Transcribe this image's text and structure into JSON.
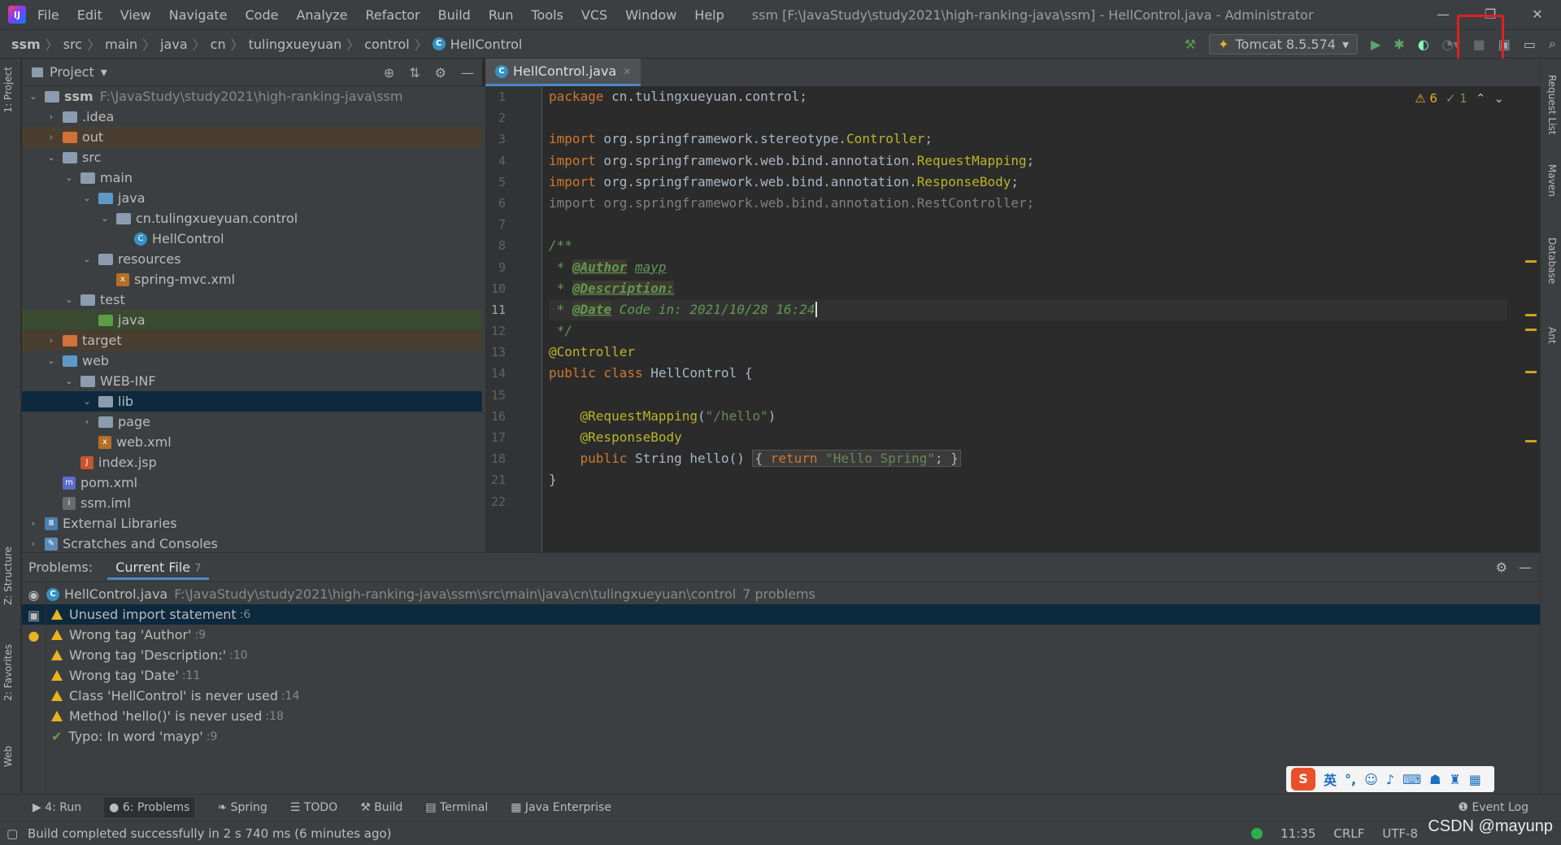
{
  "window": {
    "menu": [
      "File",
      "Edit",
      "View",
      "Navigate",
      "Code",
      "Analyze",
      "Refactor",
      "Build",
      "Run",
      "Tools",
      "VCS",
      "Window",
      "Help"
    ],
    "title": "ssm [F:\\JavaStudy\\study2021\\high-ranking-java\\ssm] - HellControl.java - Administrator"
  },
  "breadcrumb": [
    "ssm",
    "src",
    "main",
    "java",
    "cn",
    "tulingxueyuan",
    "control",
    "HellControl"
  ],
  "run_config": "Tomcat 8.5.574",
  "project": {
    "header": "Project",
    "tree": [
      {
        "label": "ssm",
        "path": "F:\\JavaStudy\\study2021\\high-ranking-java\\ssm",
        "depth": 0,
        "icon": "module",
        "arrow": "open"
      },
      {
        "label": ".idea",
        "depth": 1,
        "icon": "gray",
        "arrow": "closed"
      },
      {
        "label": "out",
        "depth": 1,
        "icon": "orange",
        "arrow": "closed"
      },
      {
        "label": "src",
        "depth": 1,
        "icon": "gray",
        "arrow": "open"
      },
      {
        "label": "main",
        "depth": 2,
        "icon": "gray",
        "arrow": "open"
      },
      {
        "label": "java",
        "depth": 3,
        "icon": "blue",
        "arrow": "open"
      },
      {
        "label": "cn.tulingxueyuan.control",
        "depth": 4,
        "icon": "package",
        "arrow": "open"
      },
      {
        "label": "HellControl",
        "depth": 5,
        "icon": "class",
        "arrow": ""
      },
      {
        "label": "resources",
        "depth": 3,
        "icon": "gray",
        "arrow": "open"
      },
      {
        "label": "spring-mvc.xml",
        "depth": 4,
        "icon": "xml",
        "arrow": ""
      },
      {
        "label": "test",
        "depth": 2,
        "icon": "gray",
        "arrow": "open"
      },
      {
        "label": "java",
        "depth": 3,
        "icon": "green",
        "arrow": ""
      },
      {
        "label": "target",
        "depth": 1,
        "icon": "orange",
        "arrow": "closed"
      },
      {
        "label": "web",
        "depth": 1,
        "icon": "blue",
        "arrow": "open"
      },
      {
        "label": "WEB-INF",
        "depth": 2,
        "icon": "gray",
        "arrow": "open"
      },
      {
        "label": "lib",
        "depth": 3,
        "icon": "gray",
        "arrow": "open"
      },
      {
        "label": "page",
        "depth": 3,
        "icon": "gray",
        "arrow": "closed"
      },
      {
        "label": "web.xml",
        "depth": 3,
        "icon": "xml",
        "arrow": ""
      },
      {
        "label": "index.jsp",
        "depth": 2,
        "icon": "jsp",
        "arrow": ""
      },
      {
        "label": "pom.xml",
        "depth": 1,
        "icon": "maven",
        "arrow": ""
      },
      {
        "label": "ssm.iml",
        "depth": 1,
        "icon": "iml",
        "arrow": ""
      },
      {
        "label": "External Libraries",
        "depth": 0,
        "icon": "libs",
        "arrow": "closed"
      },
      {
        "label": "Scratches and Consoles",
        "depth": 0,
        "icon": "scratch",
        "arrow": "closed"
      }
    ]
  },
  "editor": {
    "tab": "HellControl.java",
    "line_numbers": [
      "1",
      "2",
      "3",
      "4",
      "5",
      "6",
      "7",
      "8",
      "9",
      "10",
      "11",
      "12",
      "13",
      "14",
      "15",
      "16",
      "17",
      "18",
      "21",
      "22"
    ],
    "current_line": "11",
    "inspections": {
      "warnings": "6",
      "typos": "1"
    }
  },
  "problems": {
    "title": "Problems:",
    "tab": "Current File",
    "tab_count": "7",
    "file": "HellControl.java",
    "file_path": "F:\\JavaStudy\\study2021\\high-ranking-java\\ssm\\src\\main\\java\\cn\\tulingxueyuan\\control",
    "count": "7 problems",
    "items": [
      {
        "text": "Unused import statement",
        "line": ":6",
        "kind": "warn"
      },
      {
        "text": "Wrong tag 'Author'",
        "line": ":9",
        "kind": "warn"
      },
      {
        "text": "Wrong tag 'Description:'",
        "line": ":10",
        "kind": "warn"
      },
      {
        "text": "Wrong tag 'Date'",
        "line": ":11",
        "kind": "warn"
      },
      {
        "text": "Class 'HellControl' is never used",
        "line": ":14",
        "kind": "warn"
      },
      {
        "text": "Method 'hello()' is never used",
        "line": ":18",
        "kind": "warn"
      },
      {
        "text": "Typo: In word 'mayp'",
        "line": ":9",
        "kind": "typo"
      }
    ]
  },
  "side_left": [
    "1: Project",
    "Z: Structure",
    "2: Favorites",
    "Web"
  ],
  "side_right": [
    "Request List",
    "Maven",
    "Database",
    "Ant"
  ],
  "bottom_tabs": [
    "4: Run",
    "6: Problems",
    "Spring",
    "TODO",
    "Build",
    "Terminal",
    "Java Enterprise"
  ],
  "event_log": "Event Log",
  "status": {
    "message": "Build completed successfully in 2 s 740 ms (6 minutes ago)",
    "time": "11:35",
    "line_sep": "CRLF",
    "encoding": "UTF-8"
  },
  "ime": {
    "mode": "英"
  },
  "watermark": "CSDN @mayunp"
}
